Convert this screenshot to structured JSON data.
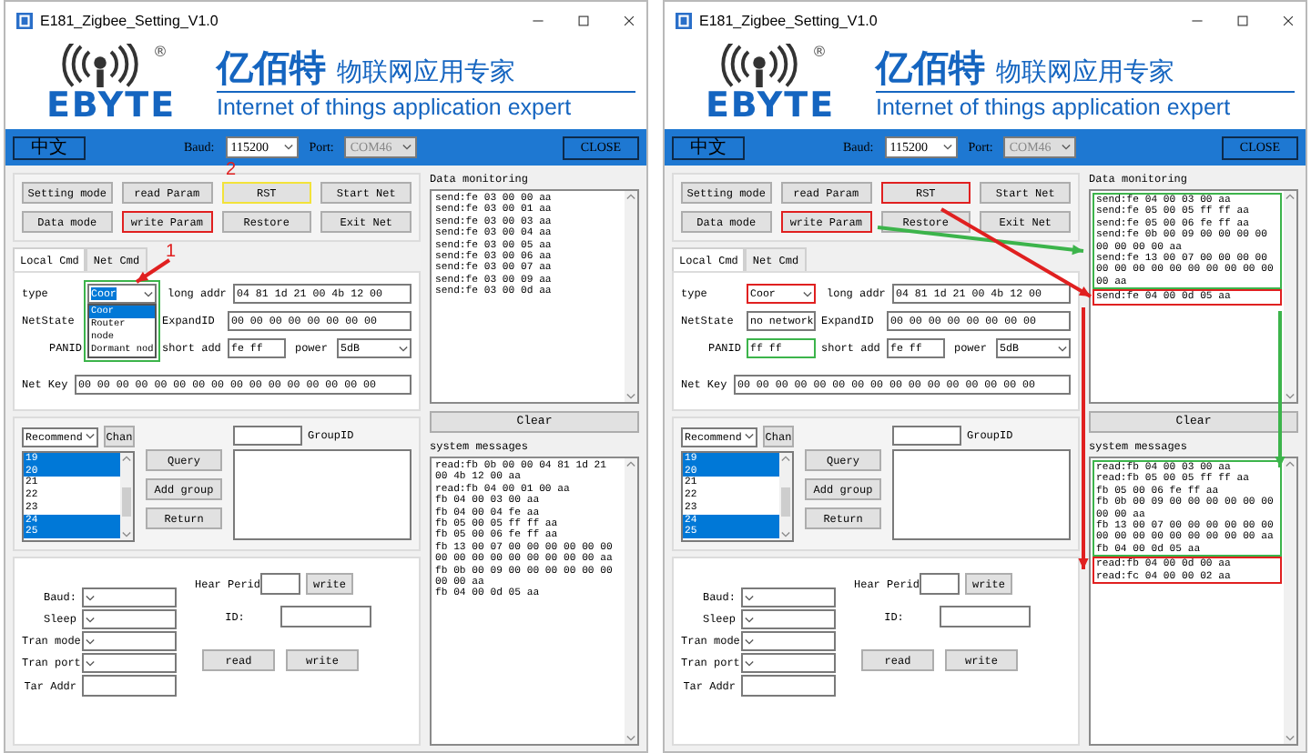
{
  "windows": [
    {
      "title": "E181_Zigbee_Setting_V1.0",
      "logo": {
        "registered": "®",
        "brand": "EBYTE",
        "name_cn": "亿佰特",
        "slogan_cn": "物联网应用专家",
        "slogan_en": "Internet of things application expert"
      },
      "top_bar": {
        "language_button": "中文",
        "baud_label": "Baud:",
        "baud": "115200",
        "port_label": "Port:",
        "port": "COM46",
        "port_disabled": true,
        "close_button": "CLOSE"
      },
      "buttons": [
        {
          "label": "Setting mode"
        },
        {
          "label": "read Param"
        },
        {
          "label": "RST",
          "color": "#f2e23a"
        },
        {
          "label": "Start Net"
        },
        {
          "label": "Data mode"
        },
        {
          "label": "write Param",
          "color": "#e02020"
        },
        {
          "label": "Restore"
        },
        {
          "label": "Exit Net"
        }
      ],
      "tabs": [
        {
          "label": "Local Cmd",
          "selected": true
        },
        {
          "label": "Net Cmd",
          "selected": false
        }
      ],
      "local_cmd": {
        "type": {
          "label": "type",
          "value": "Coor",
          "expanded": true,
          "color": "#3cb44b",
          "options": [
            {
              "label": "Coor",
              "selected": true
            },
            {
              "label": "Router",
              "selected": false
            },
            {
              "label": "node",
              "selected": false
            },
            {
              "label": "Dormant nod",
              "selected": false
            }
          ]
        },
        "long_addr": {
          "label": "long addr",
          "value": "04 81 1d 21 00 4b 12 00"
        },
        "net_state": {
          "label": "NetState"
        },
        "expand_id": {
          "label": "ExpandID",
          "value": "00 00 00 00 00 00 00 00"
        },
        "panid": {
          "label": "PANID"
        },
        "short_addr": {
          "label": "short add",
          "value": "fe ff"
        },
        "power": {
          "label": "power",
          "value": "5dB"
        },
        "net_key": {
          "label": "Net Key",
          "value": "00 00 00 00 00 00 00 00 00 00 00 00 00 00 00 00"
        }
      },
      "channels": {
        "mode": "Recommend",
        "chan_button": "Chan",
        "group_id_label": "GroupID",
        "actions": [
          "Query",
          "Add group",
          "Return"
        ],
        "items": [
          {
            "label": "19",
            "selected": true
          },
          {
            "label": "20",
            "selected": true
          },
          {
            "label": "21",
            "selected": false
          },
          {
            "label": "22",
            "selected": false
          },
          {
            "label": "23",
            "selected": false
          },
          {
            "label": "24",
            "selected": true
          },
          {
            "label": "25",
            "selected": true
          }
        ]
      },
      "serial": {
        "fields": [
          {
            "kind": "select",
            "label": "Baud:"
          },
          {
            "kind": "select",
            "label": "Sleep"
          },
          {
            "kind": "select",
            "label": "Tran mode"
          },
          {
            "kind": "select",
            "label": "Tran port"
          },
          {
            "kind": "input",
            "label": "Tar Addr"
          }
        ],
        "hear_period_label": "Hear Perid",
        "hear_write_button": "write",
        "id_label": "ID:",
        "read_button": "read",
        "write_button": "write"
      },
      "data_monitoring": {
        "label": "Data monitoring",
        "groups": [
          {
            "lines": [
              "send:fe 03 00 00 aa",
              "send:fe 03 00 01 aa",
              "send:fe 03 00 03 aa",
              "send:fe 03 00 04 aa",
              "send:fe 03 00 05 aa",
              "send:fe 03 00 06 aa",
              "send:fe 03 00 07 aa",
              "send:fe 03 00 09 aa",
              "send:fe 03 00 0d aa"
            ]
          }
        ]
      },
      "clear_button": "Clear",
      "system_messages": {
        "label": "system messages",
        "groups": [
          {
            "lines": [
              "read:fb 0b 00 00 04 81 1d 21 00 4b 12 00 aa",
              "read:fb 04 00 01 00 aa",
              "fb 04 00 03 00 aa",
              "fb 04 00 04 fe aa",
              "fb 05 00 05 ff ff aa",
              "fb 05 00 06 fe ff aa",
              "fb 13 00 07 00 00 00 00 00 00 00 00 00 00 00 00 00 00 00 aa",
              "fb 0b 00 09 00 00 00 00 00 00 00 00 aa",
              "fb 04 00 0d 05 aa"
            ]
          }
        ]
      },
      "annotations": [
        {
          "text": "2",
          "color": "#e02020"
        },
        {
          "text": "1",
          "color": "#e02020"
        }
      ],
      "arrows": [
        {
          "color": "#e02020"
        }
      ]
    },
    {
      "title": "E181_Zigbee_Setting_V1.0",
      "logo": {
        "registered": "®",
        "brand": "EBYTE",
        "name_cn": "亿佰特",
        "slogan_cn": "物联网应用专家",
        "slogan_en": "Internet of things application expert"
      },
      "top_bar": {
        "language_button": "中文",
        "baud_label": "Baud:",
        "baud": "115200",
        "port_label": "Port:",
        "port": "COM46",
        "port_disabled": true,
        "close_button": "CLOSE"
      },
      "buttons": [
        {
          "label": "Setting mode"
        },
        {
          "label": "read Param"
        },
        {
          "label": "RST",
          "color": "#e02020"
        },
        {
          "label": "Start Net"
        },
        {
          "label": "Data mode"
        },
        {
          "label": "write Param",
          "color": "#e02020"
        },
        {
          "label": "Restore"
        },
        {
          "label": "Exit Net"
        }
      ],
      "tabs": [
        {
          "label": "Local Cmd",
          "selected": true
        },
        {
          "label": "Net Cmd",
          "selected": false
        }
      ],
      "local_cmd": {
        "type": {
          "label": "type",
          "value": "Coor",
          "expanded": false,
          "color": "#e02020"
        },
        "long_addr": {
          "label": "long addr",
          "value": "04 81 1d 21 00 4b 12 00"
        },
        "net_state": {
          "label": "NetState",
          "value": "no network"
        },
        "expand_id": {
          "label": "ExpandID",
          "value": "00 00 00 00 00 00 00 00"
        },
        "panid": {
          "label": "PANID",
          "value": "ff ff",
          "color": "#3cb44b"
        },
        "short_addr": {
          "label": "short add",
          "value": "fe ff"
        },
        "power": {
          "label": "power",
          "value": "5dB"
        },
        "net_key": {
          "label": "Net Key",
          "value": "00 00 00 00 00 00 00 00 00 00 00 00 00 00 00 00"
        }
      },
      "channels": {
        "mode": "Recommend",
        "chan_button": "Chan",
        "group_id_label": "GroupID",
        "actions": [
          "Query",
          "Add group",
          "Return"
        ],
        "items": [
          {
            "label": "19",
            "selected": true
          },
          {
            "label": "20",
            "selected": true
          },
          {
            "label": "21",
            "selected": false
          },
          {
            "label": "22",
            "selected": false
          },
          {
            "label": "23",
            "selected": false
          },
          {
            "label": "24",
            "selected": true
          },
          {
            "label": "25",
            "selected": true
          }
        ]
      },
      "serial": {
        "fields": [
          {
            "kind": "select",
            "label": "Baud:"
          },
          {
            "kind": "select",
            "label": "Sleep"
          },
          {
            "kind": "select",
            "label": "Tran mode"
          },
          {
            "kind": "select",
            "label": "Tran port"
          },
          {
            "kind": "input",
            "label": "Tar Addr"
          }
        ],
        "hear_period_label": "Hear Perid",
        "hear_write_button": "write",
        "id_label": "ID:",
        "read_button": "read",
        "write_button": "write"
      },
      "data_monitoring": {
        "label": "Data monitoring",
        "groups": [
          {
            "lines": [
              "send:fe 04 00 03 00 aa",
              "send:fe 05 00 05 ff ff aa",
              "send:fe 05 00 06 fe ff aa",
              "send:fe 0b 00 09 00 00 00 00 00 00 00 00 aa",
              "send:fe 13 00 07 00 00 00 00 00 00 00 00 00 00 00 00 00 00 00 aa"
            ],
            "color": "#3cb44b"
          },
          {
            "lines": [
              "send:fe 04 00 0d 05 aa"
            ],
            "color": "#e02020"
          }
        ]
      },
      "clear_button": "Clear",
      "system_messages": {
        "label": "system messages",
        "groups": [
          {
            "lines": [
              "read:fb 04 00 03 00 aa",
              "read:fb 05 00 05 ff ff aa",
              "fb 05 00 06 fe ff aa",
              "fb 0b 00 09 00 00 00 00 00 00 00 00 aa",
              "fb 13 00 07 00 00 00 00 00 00 00 00 00 00 00 00 00 00 00 aa",
              "fb 04 00 0d 05 aa"
            ],
            "color": "#3cb44b"
          },
          {
            "lines": [
              "read:fb 04 00 0d 00 aa",
              "read:fc 04 00 00 02 aa"
            ],
            "color": "#e02020"
          }
        ]
      },
      "arrows": [
        {
          "color": "#3cb44b"
        },
        {
          "color": "#e02020"
        },
        {
          "color": "#e02020"
        },
        {
          "color": "#3cb44b"
        }
      ]
    }
  ]
}
